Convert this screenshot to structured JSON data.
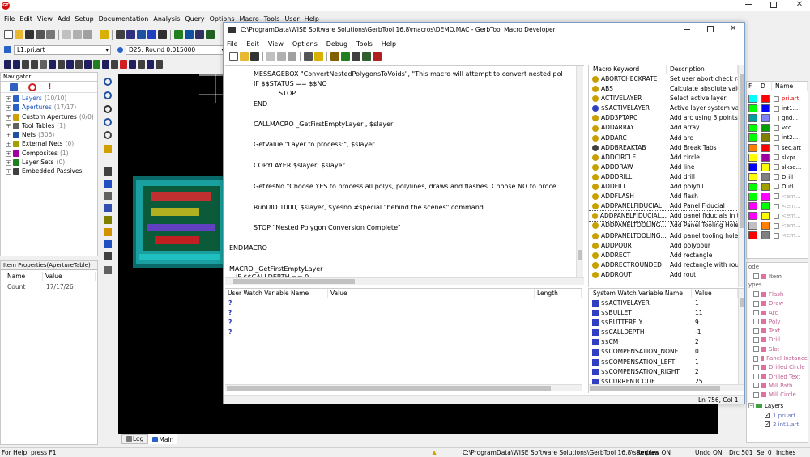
{
  "app": {
    "logo_text": "GT",
    "menu": [
      "File",
      "Edit",
      "View",
      "Add",
      "Setup",
      "Documentation",
      "Analysis",
      "Query",
      "Options",
      "Macro",
      "Tools",
      "User",
      "Help"
    ],
    "layer_select": "L1:pri.art",
    "dcode_select": "D25: Round 0.015000"
  },
  "navigator": {
    "title": "Navigator",
    "items": [
      {
        "label": "Layers",
        "count": "(10/10)",
        "color": "#1a55c0"
      },
      {
        "label": "Apertures",
        "count": "(17/17)",
        "color": "#1a55c0"
      },
      {
        "label": "Custom Apertures",
        "count": "(0/0)",
        "color": "#000"
      },
      {
        "label": "Tool Tables",
        "count": "(1)",
        "color": "#000"
      },
      {
        "label": "Nets",
        "count": "(306)",
        "color": "#000"
      },
      {
        "label": "External Nets",
        "count": "(0)",
        "color": "#000"
      },
      {
        "label": "Composites",
        "count": "(1)",
        "color": "#000"
      },
      {
        "label": "Layer Sets",
        "count": "(0)",
        "color": "#000"
      },
      {
        "label": "Embedded Passives",
        "count": "",
        "color": "#000"
      }
    ]
  },
  "item_props": {
    "title": "Item Properties(ApertureTable)",
    "col_name": "Name",
    "col_value": "Value",
    "row_name": "Count",
    "row_value": "17/17/26"
  },
  "main_tabs": [
    "Log",
    "Main"
  ],
  "macro_window": {
    "title": "C:\\ProgramData\\WISE Software Solutions\\GerbTool 16.8\\macros\\DEMO.MAC - GerbTool Macro Developer",
    "menu": [
      "File",
      "Edit",
      "View",
      "Options",
      "Debug",
      "Tools",
      "Help"
    ],
    "code": [
      "MESSAGEBOX \"ConvertNestedPolygonsToVoids\", \"This macro will attempt to convert nested pol",
      "IF $$STATUS == $$NO",
      "STOP",
      "END",
      "CALLMACRO  _GetFirstEmptyLayer , $slayer",
      "GetValue          \"Layer to process:\", $slayer",
      "COPYLAYER $slayer, $slayer",
      "GetYesNo  \"Choose YES to process all polys, polylines, draws and flashes. Choose NO to proce",
      "RunUID 1000, $slayer, $yesno #special \"behind the scenes\" command",
      "STOP \"Nested Polygon Conversion Complete\"",
      "ENDMACRO",
      "MACRO  _GetFirstEmptyLayer",
      "IF $$CALLDEPTH == 0"
    ],
    "keyword_header": "Macro Keyword",
    "desc_header": "Description",
    "keywords": [
      {
        "k": "ABORTCHECKRATE",
        "d": "Set user abort check rat"
      },
      {
        "k": "ABS",
        "d": "Calculate absolute value"
      },
      {
        "k": "ACTIVELAYER",
        "d": "Select active layer"
      },
      {
        "k": "$SACTIVELAYER",
        "d": "Active layer system varia"
      },
      {
        "k": "ADD3PTARC",
        "d": "Add arc using 3 points"
      },
      {
        "k": "ADDARRAY",
        "d": "Add array"
      },
      {
        "k": "ADDARC",
        "d": "Add arc"
      },
      {
        "k": "ADDBREAKTAB",
        "d": "Add Break Tabs"
      },
      {
        "k": "ADDCIRCLE",
        "d": "Add circle"
      },
      {
        "k": "ADDDRAW",
        "d": "Add line"
      },
      {
        "k": "ADDDRILL",
        "d": "Add drill"
      },
      {
        "k": "ADDFILL",
        "d": "Add polyfill"
      },
      {
        "k": "ADDFLASH",
        "d": "Add flash"
      },
      {
        "k": "ADDPANELFIDUCIAL",
        "d": "Add Panel Fiducial"
      },
      {
        "k": "ADDPANELFIDUCIAL...",
        "d": "Add panel fiducials in th"
      },
      {
        "k": "ADDPANELTOOLING...",
        "d": "Add Panel Tooling Hole"
      },
      {
        "k": "ADDPANELTOOLING...",
        "d": "Add panel tooling holes"
      },
      {
        "k": "ADDPOUR",
        "d": "Add polypour"
      },
      {
        "k": "ADDRECT",
        "d": "Add rectangle"
      },
      {
        "k": "ADDRECTROUNDED",
        "d": "Add rectangle with roun"
      },
      {
        "k": "ADDROUT",
        "d": "Add rout"
      }
    ],
    "user_watch": {
      "col_name": "User Watch Variable Name",
      "col_value": "Value",
      "col_length": "Length",
      "rows": [
        "?",
        "?",
        "?",
        "?"
      ]
    },
    "sys_watch": {
      "col_name": "System Watch Variable Name",
      "col_value": "Value",
      "rows": [
        {
          "n": "$$ACTIVELAYER",
          "v": "1"
        },
        {
          "n": "$$BULLET",
          "v": "11"
        },
        {
          "n": "$$BUTTERFLY",
          "v": "9"
        },
        {
          "n": "$$CALLDEPTH",
          "v": "-1"
        },
        {
          "n": "$$CM",
          "v": "2"
        },
        {
          "n": "$$COMPENSATION_NONE",
          "v": "0"
        },
        {
          "n": "$$COMPENSATION_LEFT",
          "v": "1"
        },
        {
          "n": "$$COMPENSATION_RIGHT",
          "v": "2"
        },
        {
          "n": "$$CURRENTCODE",
          "v": "25"
        }
      ]
    },
    "status": "Ln 756, Col 1"
  },
  "layer_table": {
    "col_f": "F",
    "col_d": "D",
    "col_name": "Name",
    "rows": [
      {
        "f": "#00ffff",
        "d": "#ff0000",
        "name": "pri.art",
        "red": true
      },
      {
        "f": "#00ff00",
        "d": "#0000ff",
        "name": "int1..."
      },
      {
        "f": "#00a0a0",
        "d": "#8080ff",
        "name": "gnd..."
      },
      {
        "f": "#00ff00",
        "d": "#00a000",
        "name": "vcc..."
      },
      {
        "f": "#00ff00",
        "d": "#808000",
        "name": "int2..."
      },
      {
        "f": "#ff8000",
        "d": "#ff0000",
        "name": "sec.art"
      },
      {
        "f": "#ffff00",
        "d": "#a000a0",
        "name": "slkpr..."
      },
      {
        "f": "#0000ff",
        "d": "#ffff00",
        "name": "slkse..."
      },
      {
        "f": "#ffff00",
        "d": "#808080",
        "name": "Drill"
      },
      {
        "f": "#00ff00",
        "d": "#a0a000",
        "name": "Outl..."
      },
      {
        "f": "#00ff00",
        "d": "#ff00ff",
        "name": "<em...",
        "dim": true
      },
      {
        "f": "#ff00ff",
        "d": "#00ff00",
        "name": "<em...",
        "dim": true
      },
      {
        "f": "#ff00ff",
        "d": "#ffff00",
        "name": "<em...",
        "dim": true
      },
      {
        "f": "#c0c0c0",
        "d": "#ff8000",
        "name": "<em...",
        "dim": true
      },
      {
        "f": "#ff0000",
        "d": "#808080",
        "name": "<em...",
        "dim": true
      }
    ]
  },
  "select_panel": {
    "items": [
      "Item",
      "Flash",
      "Draw",
      "Arc",
      "Poly",
      "Text",
      "Drill",
      "Slot",
      "Panel Instance",
      "Drilled Circle",
      "Drilled Text",
      "Mill Path",
      "Mill Circle"
    ],
    "headers": [
      "ode",
      "ypes"
    ],
    "layers_label": "Layers",
    "layers": [
      "1 pri.art",
      "2 int1.art"
    ]
  },
  "status_bar": {
    "help": "For Help, press F1",
    "path": "C:\\ProgramData\\WISE Software Solutions\\GerbTool 16.8\\samples",
    "redraw": "Redraw ON",
    "undo": "Undo ON",
    "drc": "Drc 501",
    "sel": "Sel 0",
    "units": "Inches"
  },
  "colors": {
    "canvas": "#000000",
    "board": "#1aa0a0",
    "accent": "#0a64c8"
  }
}
